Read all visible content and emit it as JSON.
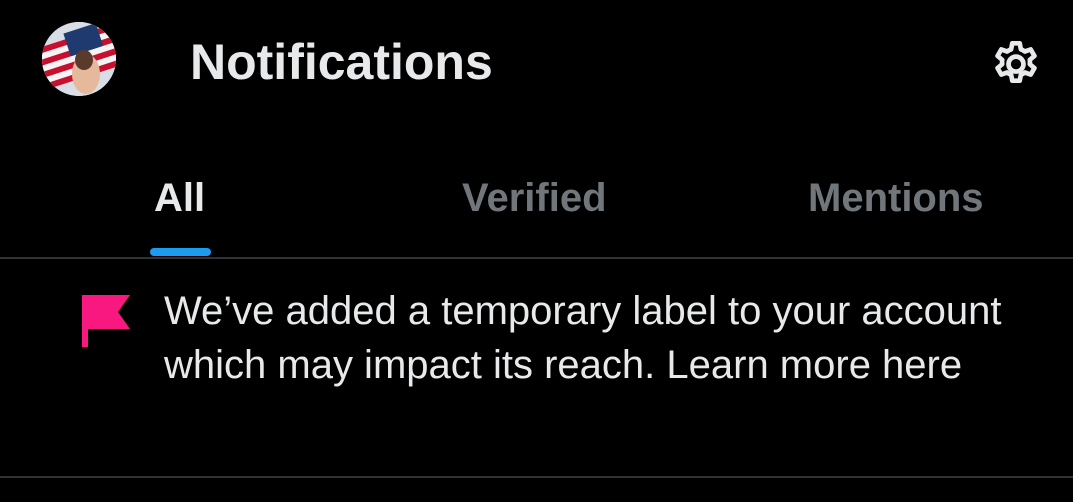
{
  "header": {
    "title": "Notifications",
    "avatar_icon": "avatar-flag-photo",
    "settings_icon": "gear-icon"
  },
  "tabs": [
    {
      "label": "All",
      "selected": true
    },
    {
      "label": "Verified",
      "selected": false
    },
    {
      "label": "Mentions",
      "selected": false
    }
  ],
  "notice": {
    "icon": "flag-icon",
    "text": "We’ve added a temporary label to your account which may impact its reach. Learn more here"
  },
  "colors": {
    "background": "#000000",
    "text_primary": "#e7e9ea",
    "text_secondary": "#71767b",
    "accent": "#1d9bf0",
    "flag": "#f91880",
    "divider": "#2f3336"
  }
}
